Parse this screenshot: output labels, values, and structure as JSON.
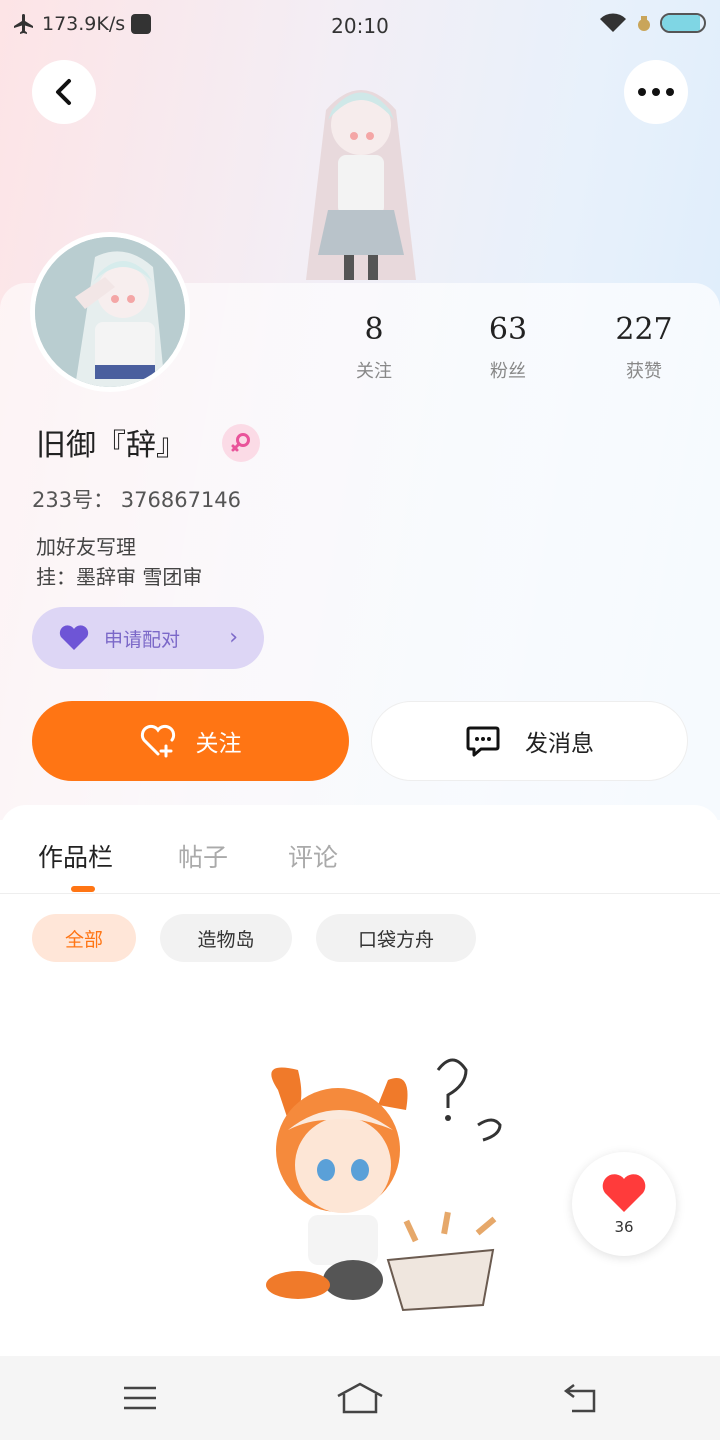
{
  "status_bar": {
    "network_speed": "173.9K/s",
    "time": "20:10",
    "battery_level": 0.9
  },
  "profile": {
    "name": "旧御『辞』",
    "uid_label": "233号：",
    "uid": "376867146",
    "bio_line1": "加好友写理",
    "bio_line2": "挂：墨辞审 雪团审",
    "pair_label": "申请配对",
    "stats": [
      {
        "value": "8",
        "label": "关注"
      },
      {
        "value": "63",
        "label": "粉丝"
      },
      {
        "value": "227",
        "label": "获赞"
      }
    ]
  },
  "actions": {
    "follow_label": "关注",
    "message_label": "发消息"
  },
  "tabs": [
    {
      "label": "作品栏",
      "active": true
    },
    {
      "label": "帖子",
      "active": false
    },
    {
      "label": "评论",
      "active": false
    }
  ],
  "filters": [
    {
      "label": "全部",
      "active": true
    },
    {
      "label": "造物岛",
      "active": false
    },
    {
      "label": "口袋方舟",
      "active": false
    }
  ],
  "likes_count": "36",
  "colors": {
    "accent": "#ff7514",
    "pair_bg": "#ddd6f5",
    "pair_fg": "#7b68c8",
    "gender": "#e9539a"
  },
  "icons": [
    "airplane-icon",
    "app-icon",
    "wifi-icon",
    "battery-icon",
    "back-icon",
    "more-icon",
    "heart-pair-icon",
    "chevron-right-icon",
    "follow-heart-icon",
    "chat-icon",
    "heart-icon",
    "menu-icon",
    "home-icon",
    "back-nav-icon",
    "female-icon"
  ]
}
